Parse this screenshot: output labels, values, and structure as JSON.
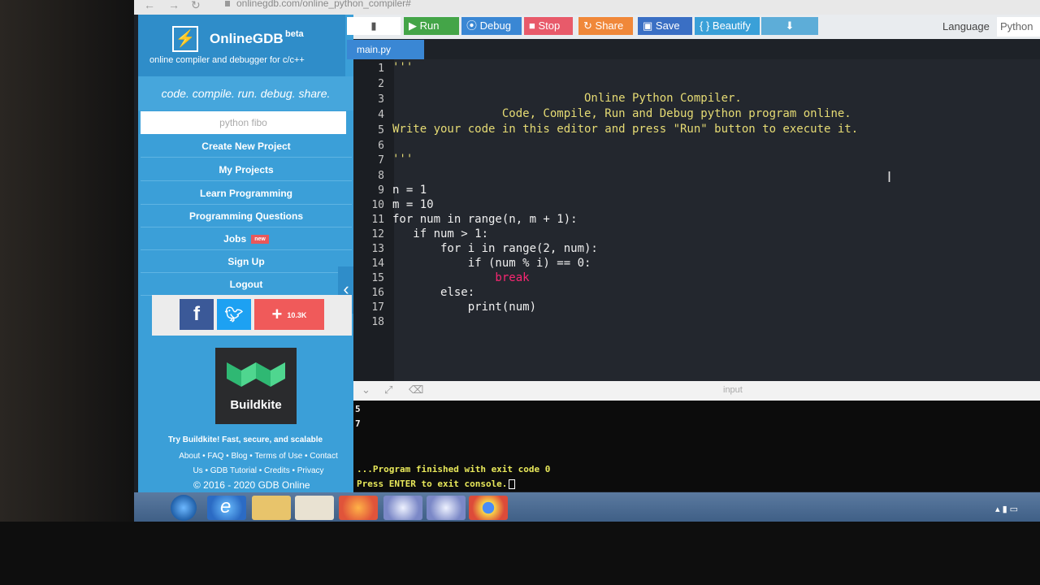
{
  "browser": {
    "url": "onlinegdb.com/online_python_compiler#"
  },
  "sidebar": {
    "brand_name": "OnlineGDB",
    "brand_beta": "beta",
    "brand_tagline": "online compiler and debugger for c/c++",
    "motto": "code. compile. run. debug. share.",
    "search_value": "python fibo",
    "menu": [
      {
        "label": "Create New Project"
      },
      {
        "label": "My Projects"
      },
      {
        "label": "Learn Programming"
      },
      {
        "label": "Programming Questions"
      },
      {
        "label": "Jobs",
        "badge": "new"
      },
      {
        "label": "Sign Up"
      },
      {
        "label": "Logout"
      }
    ],
    "share_count": "10.3K",
    "ad_name": "Buildkite",
    "ad_text": "Try Buildkite! Fast, secure, and scalable",
    "footer_line1": "About • FAQ • Blog • Terms of Use • Contact",
    "footer_line2": "Us • GDB Tutorial • Credits • Privacy",
    "copyright": "© 2016 - 2020 GDB Online"
  },
  "toolbar": {
    "run": "Run",
    "debug": "Debug",
    "stop": "Stop",
    "share": "Share",
    "save": "Save",
    "beautify": "{ } Beautify",
    "language_label": "Language",
    "language_value": "Python"
  },
  "editor": {
    "tab": "main.py",
    "line_numbers": [
      "1",
      "2",
      "3",
      "4",
      "5",
      "6",
      "7",
      "8",
      "9",
      "10",
      "11",
      "12",
      "13",
      "14",
      "15",
      "16",
      "17",
      "18"
    ],
    "lines": [
      "'''",
      "",
      "                            Online Python Compiler.",
      "                Code, Compile, Run and Debug python program online.",
      "Write your code in this editor and press \"Run\" button to execute it.",
      "",
      "'''",
      "",
      "n = 1",
      "m = 10",
      "for num in range(n, m + 1):",
      "   if num > 1:",
      "       for i in range(2, num):",
      "           if (num % i) == 0:",
      "               break",
      "       else:",
      "           print(num)",
      ""
    ]
  },
  "console": {
    "input_label": "input",
    "output_lines": [
      "5",
      "7"
    ],
    "finish_message": "...Program finished with exit code 0",
    "exit_prompt": "Press ENTER to exit console."
  },
  "colors": {
    "sidebar": "#3b9fd8",
    "run": "#44a548",
    "debug": "#3a87d4",
    "stop": "#e85a6a",
    "share": "#f0883a",
    "save": "#3a6fc4",
    "beautify": "#3aa0d8",
    "editor_bg": "#23272e",
    "comment": "#e6db74"
  }
}
